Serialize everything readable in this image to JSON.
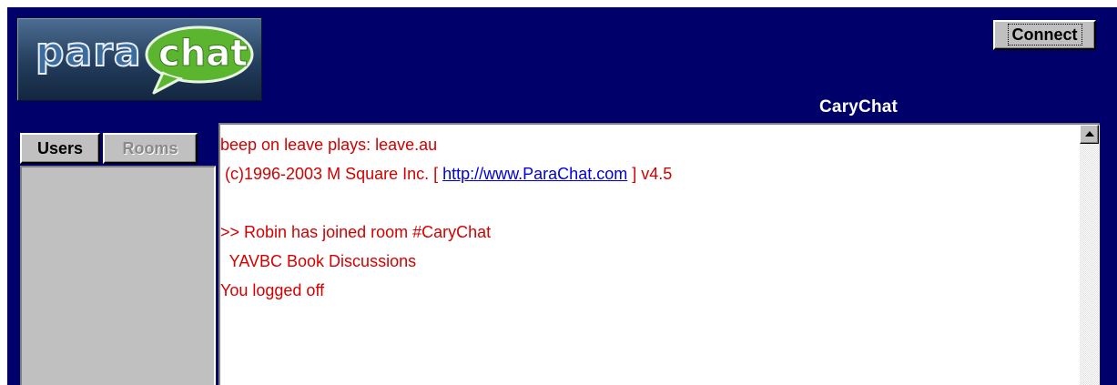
{
  "logo": {
    "part1": "para",
    "part2": "chat"
  },
  "header": {
    "connect_label": "Connect",
    "room_name": "CaryChat"
  },
  "tabs": {
    "users_label": "Users",
    "rooms_label": "Rooms"
  },
  "chat": {
    "line1": "beep on leave plays: leave.au",
    "line2_prefix": " (c)1996-2003 M Square Inc. [ ",
    "line2_link": "http://www.ParaChat.com",
    "line2_suffix": " ] v4.5",
    "line4": ">> Robin has joined room #CaryChat",
    "line5": "  YAVBC Book Discussions",
    "line6": "You logged off",
    "text_color": "#d40000",
    "link_color": "#0000e0"
  },
  "colors": {
    "background": "#00006b",
    "panel": "#c0c0c0"
  }
}
